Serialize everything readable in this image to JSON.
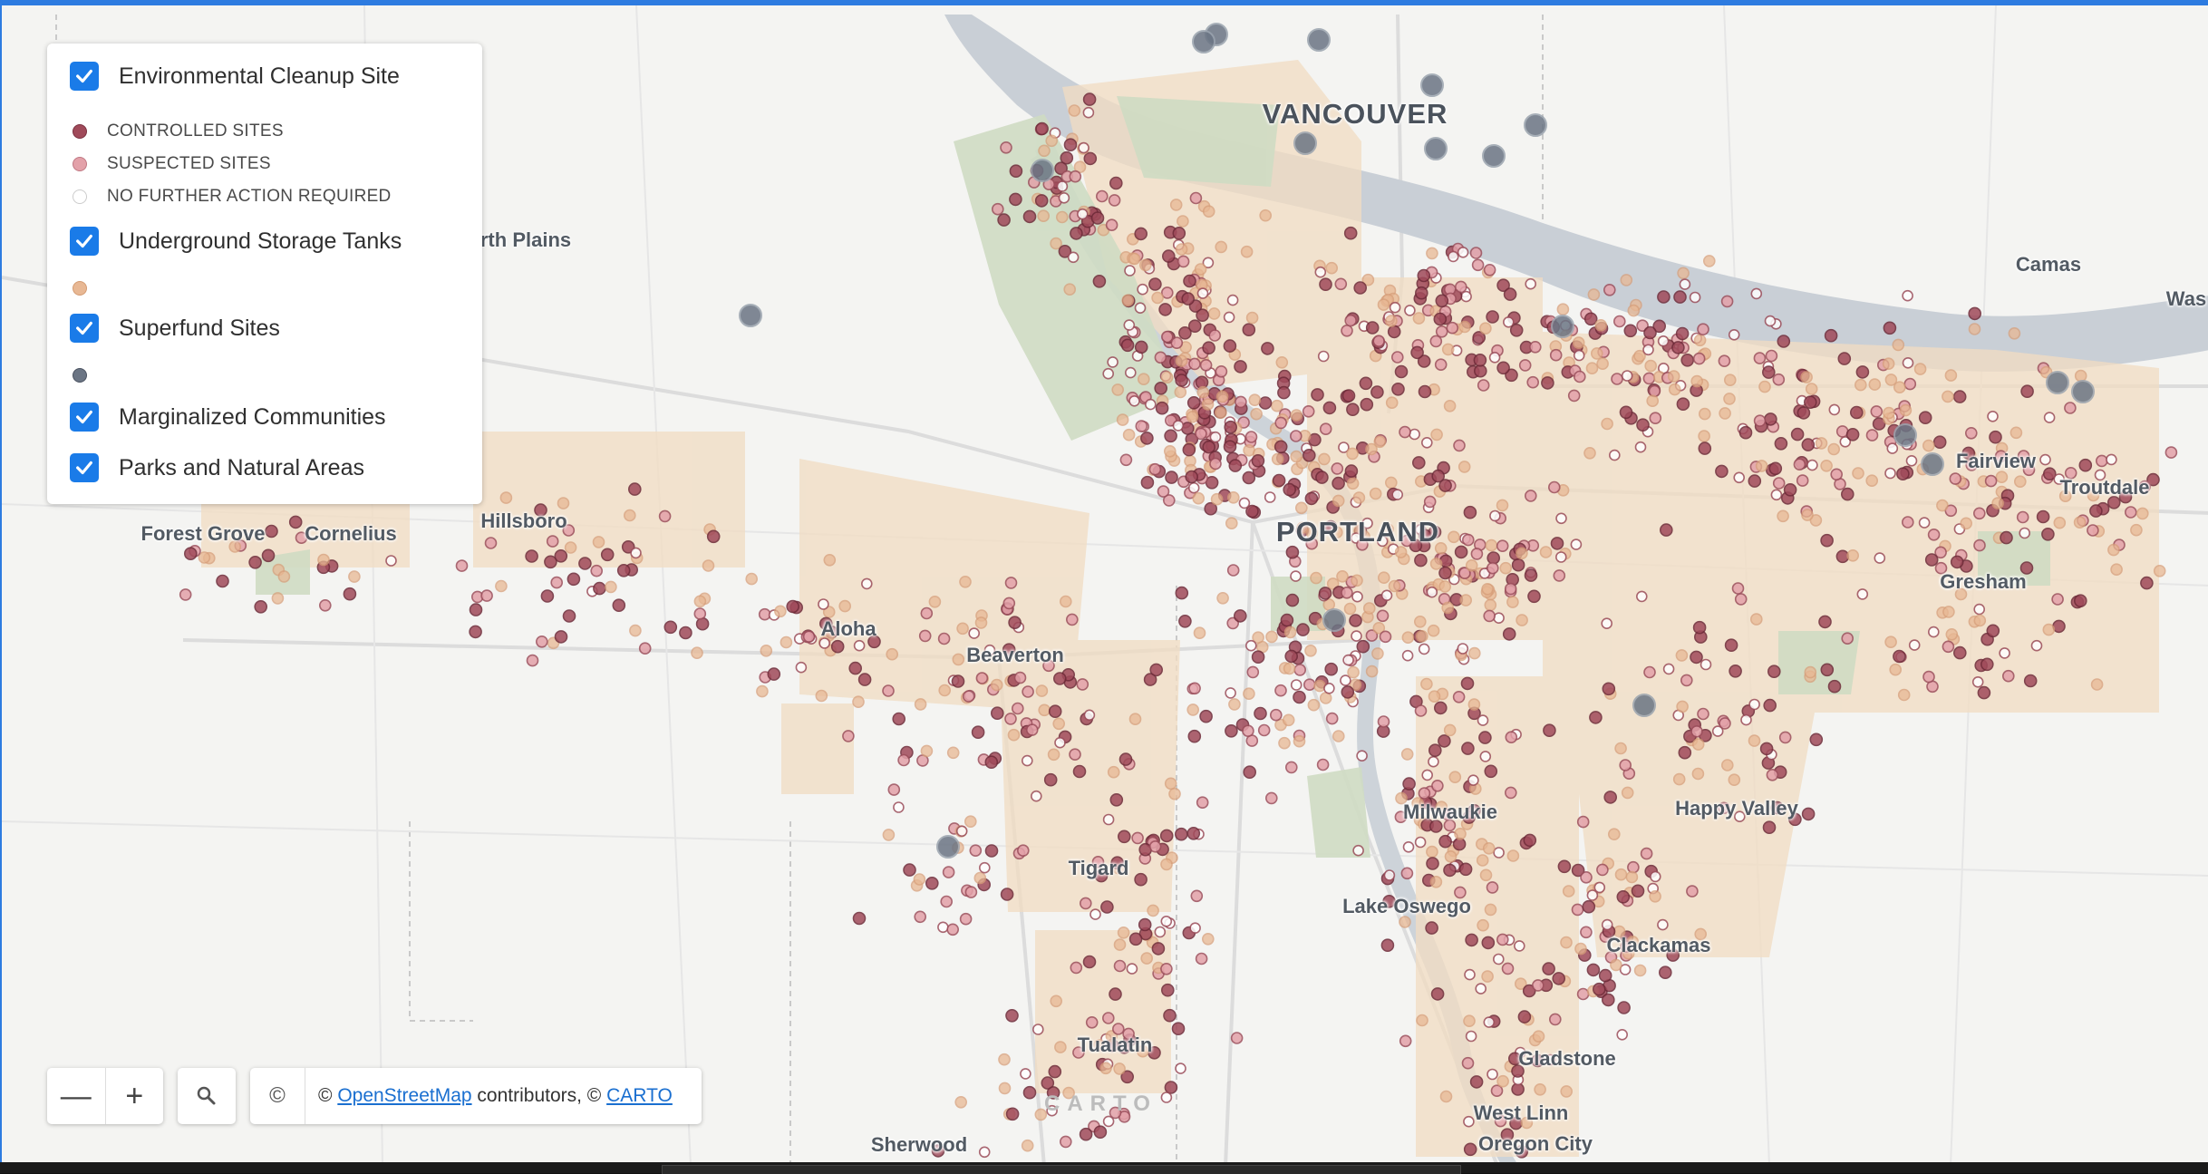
{
  "legend": {
    "layers": [
      {
        "label": "Environmental Cleanup Site",
        "checked": true
      },
      {
        "label": "Underground Storage Tanks",
        "checked": true
      },
      {
        "label": "Superfund Sites",
        "checked": true
      },
      {
        "label": "Marginalized Communities",
        "checked": true
      },
      {
        "label": "Parks and Natural Areas",
        "checked": true
      }
    ],
    "cleanup_categories": [
      {
        "label": "CONTROLLED SITES",
        "color": "#a04a5a"
      },
      {
        "label": "SUSPECTED SITES",
        "color": "#e3a1a9"
      },
      {
        "label": "NO FURTHER ACTION REQUIRED",
        "color": "#ffffff"
      }
    ],
    "ust_color": "#e8b894",
    "superfund_color": "#6b7584"
  },
  "places": {
    "vancouver": "VANCOUVER",
    "portland": "PORTLAND",
    "orchards_plains": "rth Plains",
    "camas": "Camas",
    "washougal": "Was",
    "fairview": "Fairview",
    "troutdale": "Troutdale",
    "gresham": "Gresham",
    "forest_grove": "Forest Grove",
    "cornelius": "Cornelius",
    "hillsboro": "Hillsboro",
    "aloha": "Aloha",
    "beaverton": "Beaverton",
    "happy_valley": "Happy Valley",
    "milwaukie": "Milwaukie",
    "tigard": "Tigard",
    "lake_oswego": "Lake Oswego",
    "clackamas": "Clackamas",
    "tualatin": "Tualatin",
    "gladstone": "Gladstone",
    "west_linn": "West Linn",
    "sherwood": "Sherwood",
    "oregon_city": "Oregon City"
  },
  "controls": {
    "zoom_out": "—",
    "zoom_in": "+",
    "info_symbol": "©",
    "attribution_prefix": "© ",
    "osm_link": "OpenStreetMap",
    "attribution_mid": " contributors, © ",
    "carto_link": "CARTO"
  },
  "basemap_watermark": "CARTO"
}
